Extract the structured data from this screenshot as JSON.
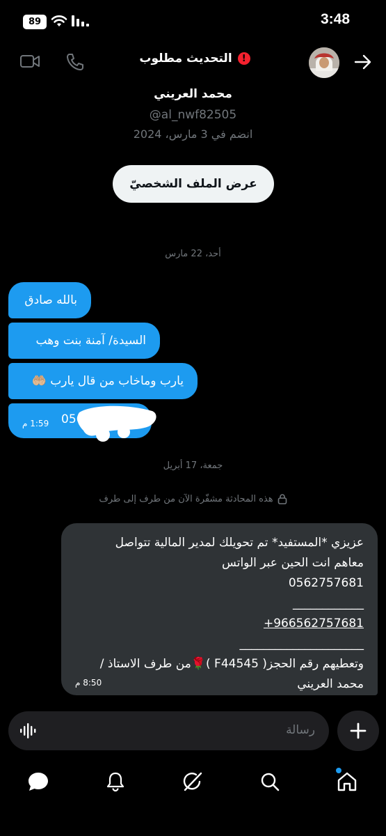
{
  "status_bar": {
    "time": "3:48",
    "battery": "89"
  },
  "header": {
    "title": "التحديث مطلوب"
  },
  "profile": {
    "name": "محمد العريني",
    "handle": "@al_nwf82505",
    "joined": "انضم في 3 مارس، 2024",
    "view_profile_label": "عرض الملف الشخصيّ"
  },
  "conversation": {
    "date1": "أحد، 22 مارس",
    "messages_received": [
      {
        "text": "بالله صادق"
      },
      {
        "text": "السيدة/ آمنة بنت وهب"
      },
      {
        "text": "يارب وماخاب من قال يارب 🤲🏼"
      },
      {
        "text": "056",
        "time": "1:59 م"
      }
    ],
    "date2": "جمعة، 17 أبريل",
    "encryption_notice": "هذه المحادثة مشفّرة الآن من طرف إلى طرف",
    "sent_message": {
      "lines": [
        "عزيزي *المستفيد* تم تحويلك لمدير المالية تتواصل",
        "معاهم انت  الحين عبر الواتس",
        "0562757681",
        "____________",
        "+966562757681",
        "_____________________",
        "وتعطيهم رقم الحجز( F44545 )🌹من طرف الاستاذ /",
        "محمد العريني"
      ],
      "time": "8:50 م"
    }
  },
  "composer": {
    "placeholder": "رسالة"
  },
  "colors": {
    "accent": "#1d9bf0",
    "background": "#000000",
    "bubble_gray": "#2f3336",
    "warning": "#f4212e"
  }
}
